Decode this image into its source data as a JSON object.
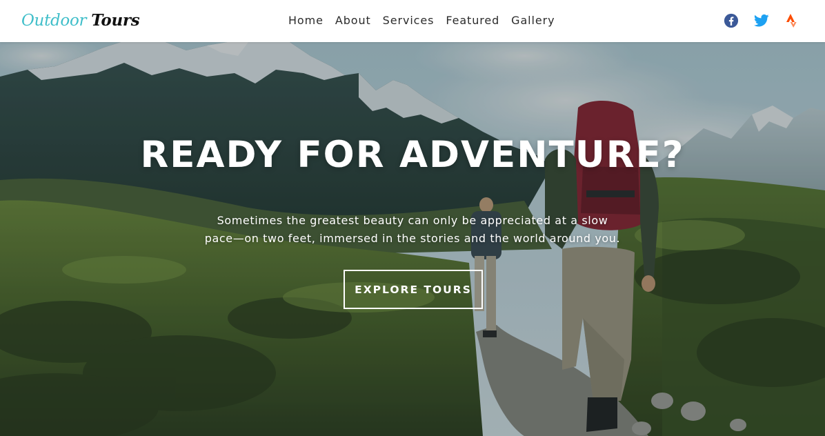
{
  "brand": {
    "first": "Outdoor",
    "second": "Tours",
    "first_color": "#3fbec9",
    "second_color": "#111111"
  },
  "nav": {
    "items": [
      {
        "label": "Home"
      },
      {
        "label": "About"
      },
      {
        "label": "Services"
      },
      {
        "label": "Featured"
      },
      {
        "label": "Gallery"
      }
    ]
  },
  "social": [
    {
      "icon": "facebook-icon",
      "color": "#3b5998"
    },
    {
      "icon": "twitter-icon",
      "color": "#1da1f2"
    },
    {
      "icon": "strava-icon",
      "color": "#fc4c02"
    }
  ],
  "hero": {
    "title": "READY FOR ADVENTURE?",
    "subtitle_line1": "Sometimes the greatest beauty can only be appreciated at a slow",
    "subtitle_line2": "pace—on two feet, immersed in the stories and the world around you.",
    "cta_label": "EXPLORE TOURS",
    "background": "hiking-trail-mountains-photo"
  }
}
